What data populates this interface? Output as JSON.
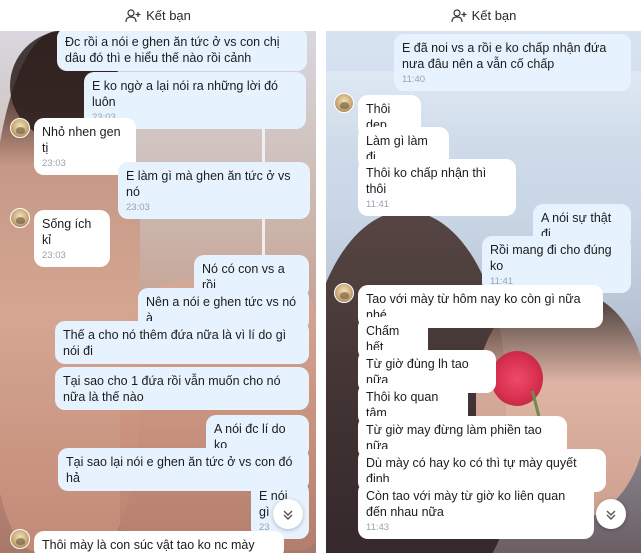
{
  "left": {
    "header": {
      "add_friend_label": "Kết bạn",
      "icon": "add-friend-icon"
    },
    "messages": [
      {
        "text": "Đc rồi a nói e ghen ăn tức ở vs con chị dâu đó thì e hiểu thế nào rồi cảnh",
        "time": ""
      },
      {
        "text": "E ko ngờ a lại nói ra những lời đó luôn",
        "time": "23:03"
      },
      {
        "text": "Nhỏ nhen gen tị",
        "time": "23:03"
      },
      {
        "text": "E làm gì mà ghen ăn tức ở vs nó",
        "time": "23:03"
      },
      {
        "text": "Sống ích kỉ",
        "time": "23:03"
      },
      {
        "text": "Nó có con vs a rồi",
        "time": ""
      },
      {
        "text": "Nên a nói e ghen tức vs nó à",
        "time": ""
      },
      {
        "text": "Thế a cho nó thêm đứa nữa là vì lí do gì nói đi",
        "time": ""
      },
      {
        "text": "Tại sao cho 1 đứa rồi vẫn muốn cho nó nữa là thế nào",
        "time": ""
      },
      {
        "text": "A nói đc lí do ko",
        "time": ""
      },
      {
        "text": "Tại sao lại nói e ghen ăn tức ở vs con đó hả",
        "time": ""
      },
      {
        "text": "E nói gì",
        "time": "23"
      },
      {
        "text": "Thôi mày là con súc vật tao ko nc mày nữa",
        "time": ""
      }
    ]
  },
  "right": {
    "header": {
      "add_friend_label": "Kết bạn",
      "icon": "add-friend-icon"
    },
    "messages": [
      {
        "text": "E đã noi vs a rồi e ko chấp nhận đứa nưa đâu nên a vẫn cố chấp",
        "time": "11:40"
      },
      {
        "text": "Thôi dẹp",
        "time": ""
      },
      {
        "text": "Làm gì làm đi",
        "time": ""
      },
      {
        "text": "Thôi ko chấp nhận thì thôi",
        "time": "11:41"
      },
      {
        "text": "A nói sự thật đi",
        "time": ""
      },
      {
        "text": "Rồi mang đi cho đúng ko",
        "time": "11:41"
      },
      {
        "text": "Tao với mày từ hôm nay ko còn gì nữa nhé",
        "time": ""
      },
      {
        "text": "Chấm hết",
        "time": ""
      },
      {
        "text": "Từ giờ đùng lh tao nữa",
        "time": ""
      },
      {
        "text": "Thôi ko quan tâm",
        "time": ""
      },
      {
        "text": "Từ giờ may đừng làm phiền tao nữa",
        "time": ""
      },
      {
        "text": "Dù mày có hay ko có thì tự mày quyết định",
        "time": ""
      },
      {
        "text": "Còn tao với mày từ giờ ko liên quan đến nhau nữa",
        "time": "11:43"
      }
    ]
  },
  "colors": {
    "outgoing_bubble": "#e6f2fe",
    "incoming_bubble": "#ffffff",
    "timestamp": "#9aa3ad"
  }
}
